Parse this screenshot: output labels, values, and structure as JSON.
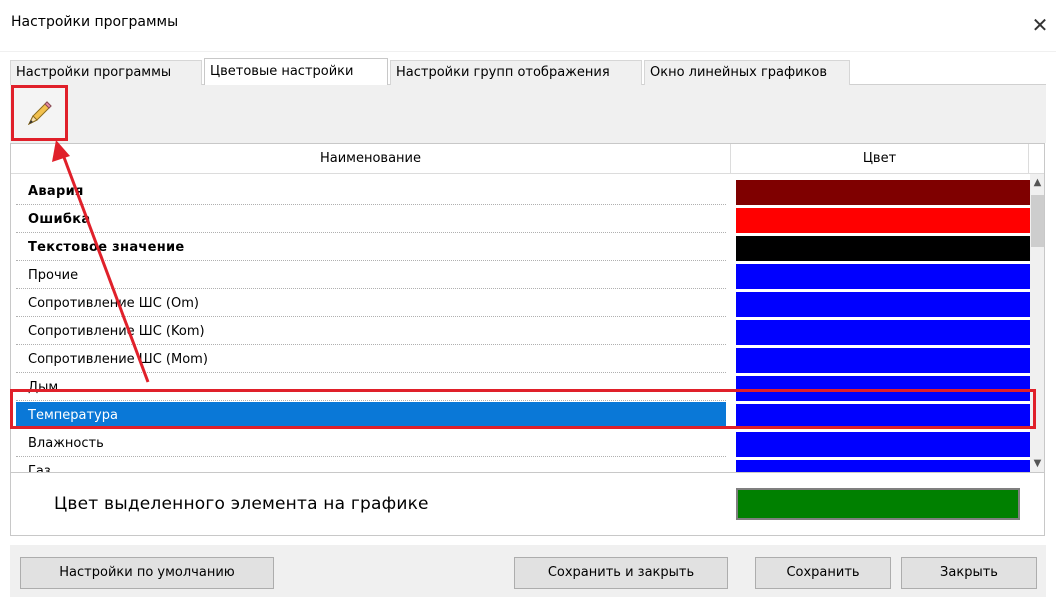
{
  "window": {
    "title": "Настройки программы",
    "close_glyph": "✕"
  },
  "tabs": [
    {
      "label": "Настройки программы",
      "active": false
    },
    {
      "label": "Цветовые настройки",
      "active": true
    },
    {
      "label": "Настройки групп отображения",
      "active": false
    },
    {
      "label": "Окно линейных графиков",
      "active": false
    }
  ],
  "toolbar": {
    "edit_icon": "pencil-icon"
  },
  "grid": {
    "header_name": "Наименование",
    "header_color": "Цвет",
    "rows": [
      {
        "name": "Авария",
        "color": "#7f0000",
        "bold": true
      },
      {
        "name": "Ошибка",
        "color": "#ff0000",
        "bold": true
      },
      {
        "name": "Текстовое значение",
        "color": "#000000",
        "bold": true
      },
      {
        "name": "Прочие",
        "color": "#0000ff",
        "bold": false
      },
      {
        "name": "Сопротивление ШС (Om)",
        "color": "#0000ff",
        "bold": false
      },
      {
        "name": "Сопротивление ШС (Kom)",
        "color": "#0000ff",
        "bold": false
      },
      {
        "name": "Сопротивление ШС (Mom)",
        "color": "#0000ff",
        "bold": false
      },
      {
        "name": "Дым",
        "color": "#0000ff",
        "bold": false
      },
      {
        "name": "Температура",
        "color": "#0000ff",
        "bold": false,
        "selected": true
      },
      {
        "name": "Влажность",
        "color": "#0000ff",
        "bold": false
      },
      {
        "name": "Газ",
        "color": "#0000ff",
        "bold": false
      }
    ]
  },
  "selected_element": {
    "label": "Цвет выделенного элемента на графике",
    "color": "#008000"
  },
  "buttons": {
    "defaults": "Настройки по умолчанию",
    "save_close": "Сохранить и закрыть",
    "save": "Сохранить",
    "close": "Закрыть"
  },
  "colors": {
    "selection": "#0a78d7",
    "annotation_red": "#e0202a"
  }
}
